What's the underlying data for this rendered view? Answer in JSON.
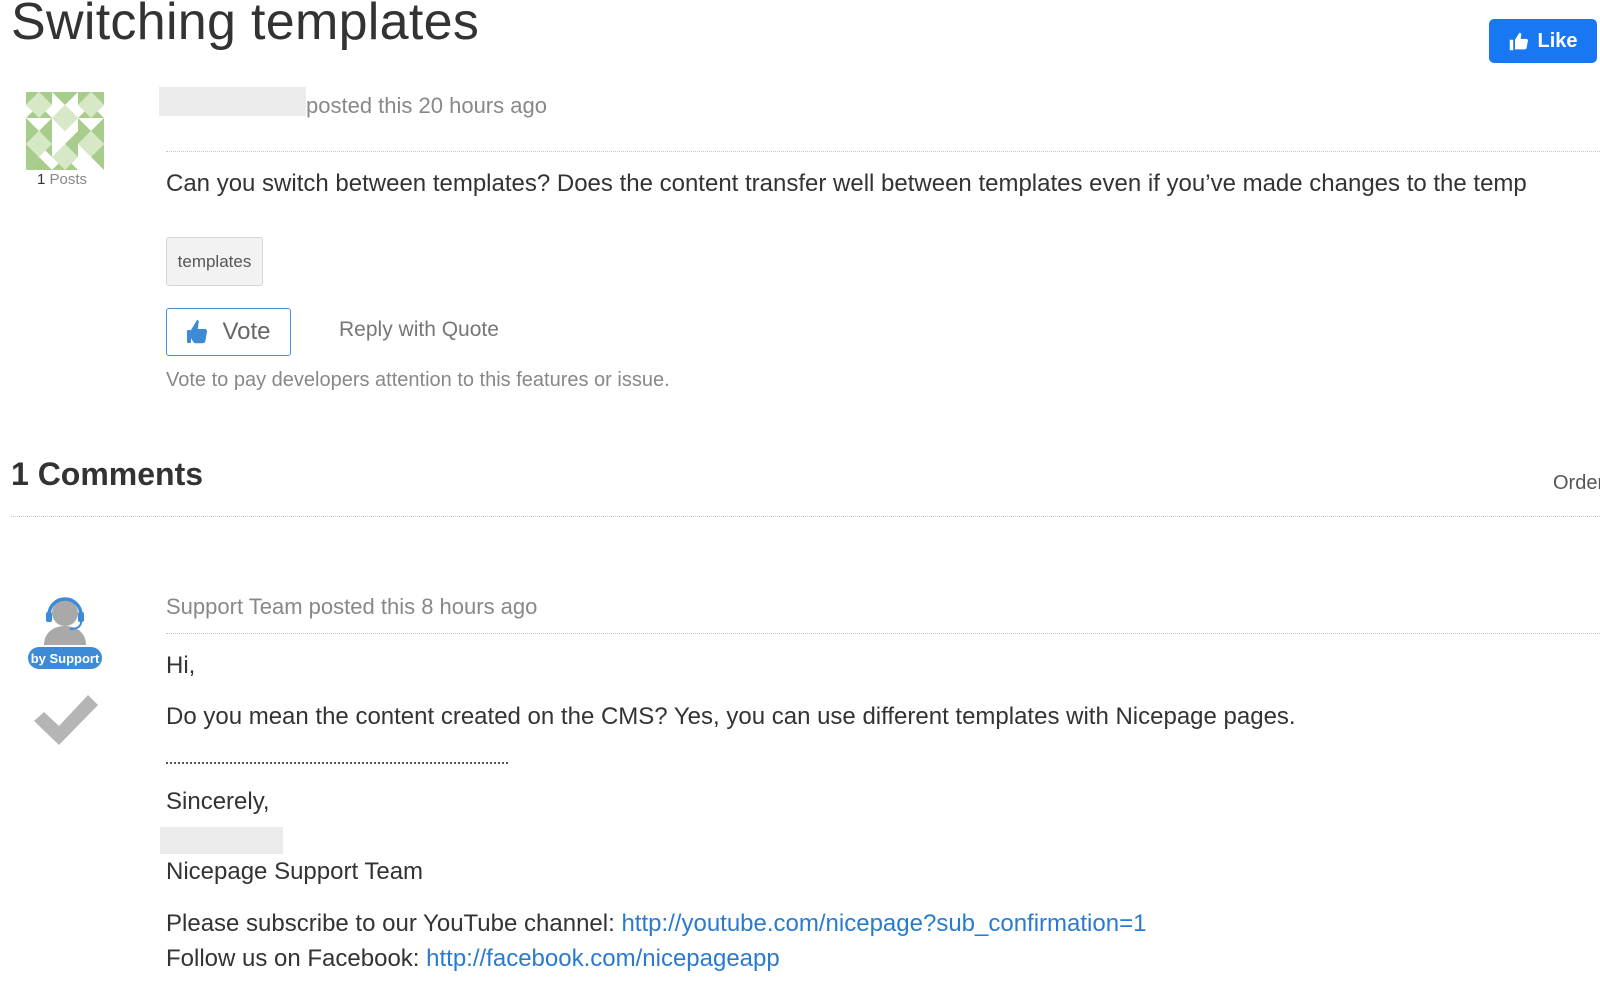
{
  "post": {
    "title": "Switching templates",
    "like_label": "Like",
    "author_posts_count": "1",
    "author_posts_label": "Posts",
    "meta": "posted this 20 hours ago",
    "body": "Can you switch between templates? Does the content transfer well between templates even if you’ve made changes to the temp",
    "tag": "templates",
    "vote_label": "Vote",
    "reply_quote_label": "Reply with Quote",
    "vote_hint": "Vote to pay developers attention to this features or issue."
  },
  "comments": {
    "heading": "1 Comments",
    "order_label": "Order",
    "items": [
      {
        "badge": "by Support",
        "meta": "Support Team posted this 8 hours ago",
        "greeting": "Hi,",
        "body": "Do you mean the content created on the CMS? Yes, you can use different templates with Nicepage pages.",
        "closing": "Sincerely,",
        "team": "Nicepage Support Team",
        "youtube_prefix": "Please subscribe to our YouTube channel: ",
        "youtube_link": "http://youtube.com/nicepage?sub_confirmation=1",
        "facebook_prefix": "Follow us on Facebook: ",
        "facebook_link": "http://facebook.com/nicepageapp"
      }
    ]
  },
  "colors": {
    "like_button": "#1877f2",
    "link": "#2a7bd0",
    "support_badge": "#3d8ad6",
    "vote_border": "#4a90d9"
  },
  "icons": {
    "like": "thumbs-up-icon",
    "vote": "thumbs-up-icon",
    "accepted": "check-icon",
    "support_avatar": "headset-user-icon",
    "author_avatar": "quilt-pattern-avatar"
  }
}
